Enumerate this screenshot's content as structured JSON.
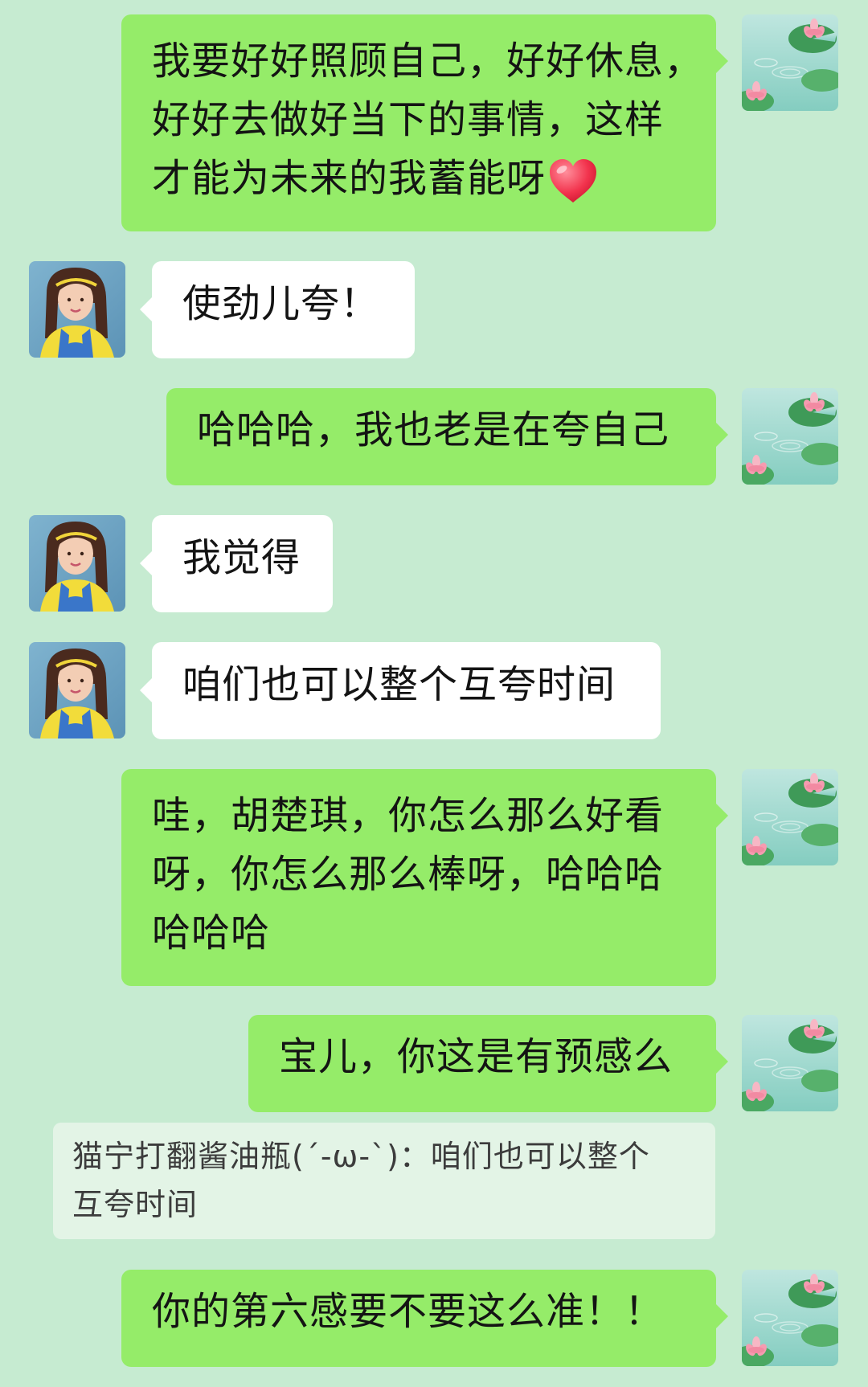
{
  "chat": {
    "messages": [
      {
        "from": "me",
        "lines": [
          "我要好好照顾自己，好好休息，",
          "好好去做好当下的事情，这样",
          "才能为未来的我蓄能呀"
        ],
        "emoji": "red-heart"
      },
      {
        "from": "other",
        "lines": [
          "使劲儿夸！"
        ]
      },
      {
        "from": "me",
        "lines": [
          "哈哈哈，我也老是在夸自己"
        ]
      },
      {
        "from": "other",
        "lines": [
          "我觉得"
        ]
      },
      {
        "from": "other",
        "lines": [
          "咱们也可以整个互夸时间"
        ]
      },
      {
        "from": "me",
        "lines": [
          "哇，胡楚琪，你怎么那么好看",
          "呀，你怎么那么棒呀，哈哈哈",
          "哈哈哈"
        ]
      },
      {
        "from": "me",
        "lines": [
          "宝儿，你这是有预感么"
        ]
      },
      {
        "from": "me",
        "lines": [
          "你的第六感要不要这么准！！"
        ]
      }
    ],
    "quote": {
      "lines": [
        "猫宁打翻酱油瓶(´-ω-`)：咱们也可以整个",
        "互夸时间"
      ]
    }
  },
  "colors": {
    "background": "#c6ebd1",
    "my_bubble": "#95ec69",
    "their_bubble": "#ffffff",
    "quote_bg": "#e3f4e6"
  }
}
